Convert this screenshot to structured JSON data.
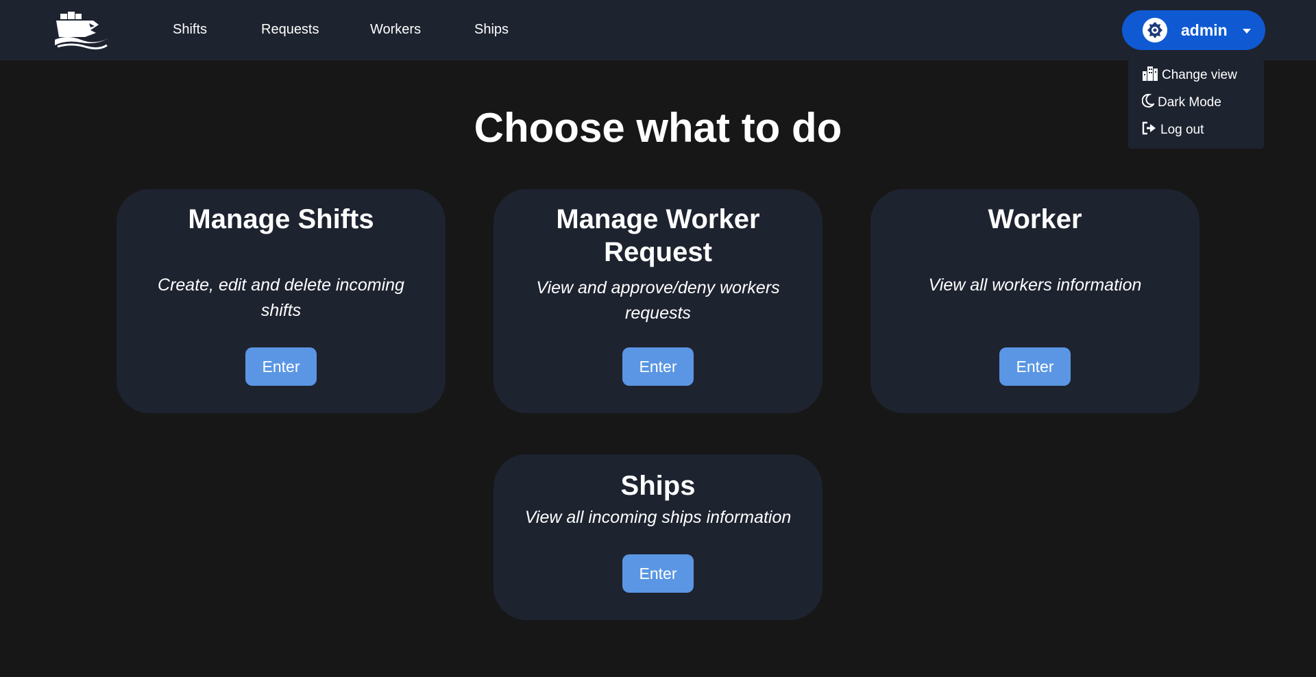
{
  "nav": {
    "links": [
      "Shifts",
      "Requests",
      "Workers",
      "Ships"
    ]
  },
  "user": {
    "name": "admin",
    "menu": [
      "Change view",
      "Dark Mode",
      "Log out"
    ]
  },
  "page": {
    "title": "Choose what to do"
  },
  "cards": [
    {
      "title": "Manage Shifts",
      "description": "Create, edit and delete incoming shifts",
      "button": "Enter"
    },
    {
      "title": "Manage Worker Request",
      "description": "View and approve/deny workers requests",
      "button": "Enter"
    },
    {
      "title": "Worker",
      "description": "View all workers information",
      "button": "Enter"
    },
    {
      "title": "Ships",
      "description": "View all incoming ships information",
      "button": "Enter"
    }
  ],
  "icons": {
    "logo": "ship-shark-logo",
    "menu": [
      "building-icon",
      "moon-icon",
      "logout-icon"
    ],
    "avatar": "avatar-emblem"
  },
  "colors": {
    "background": "#171717",
    "navbar": "#1e2330",
    "card": "#1e2330",
    "user_button": "#0f5ad2",
    "enter_button": "#5a96e3"
  }
}
